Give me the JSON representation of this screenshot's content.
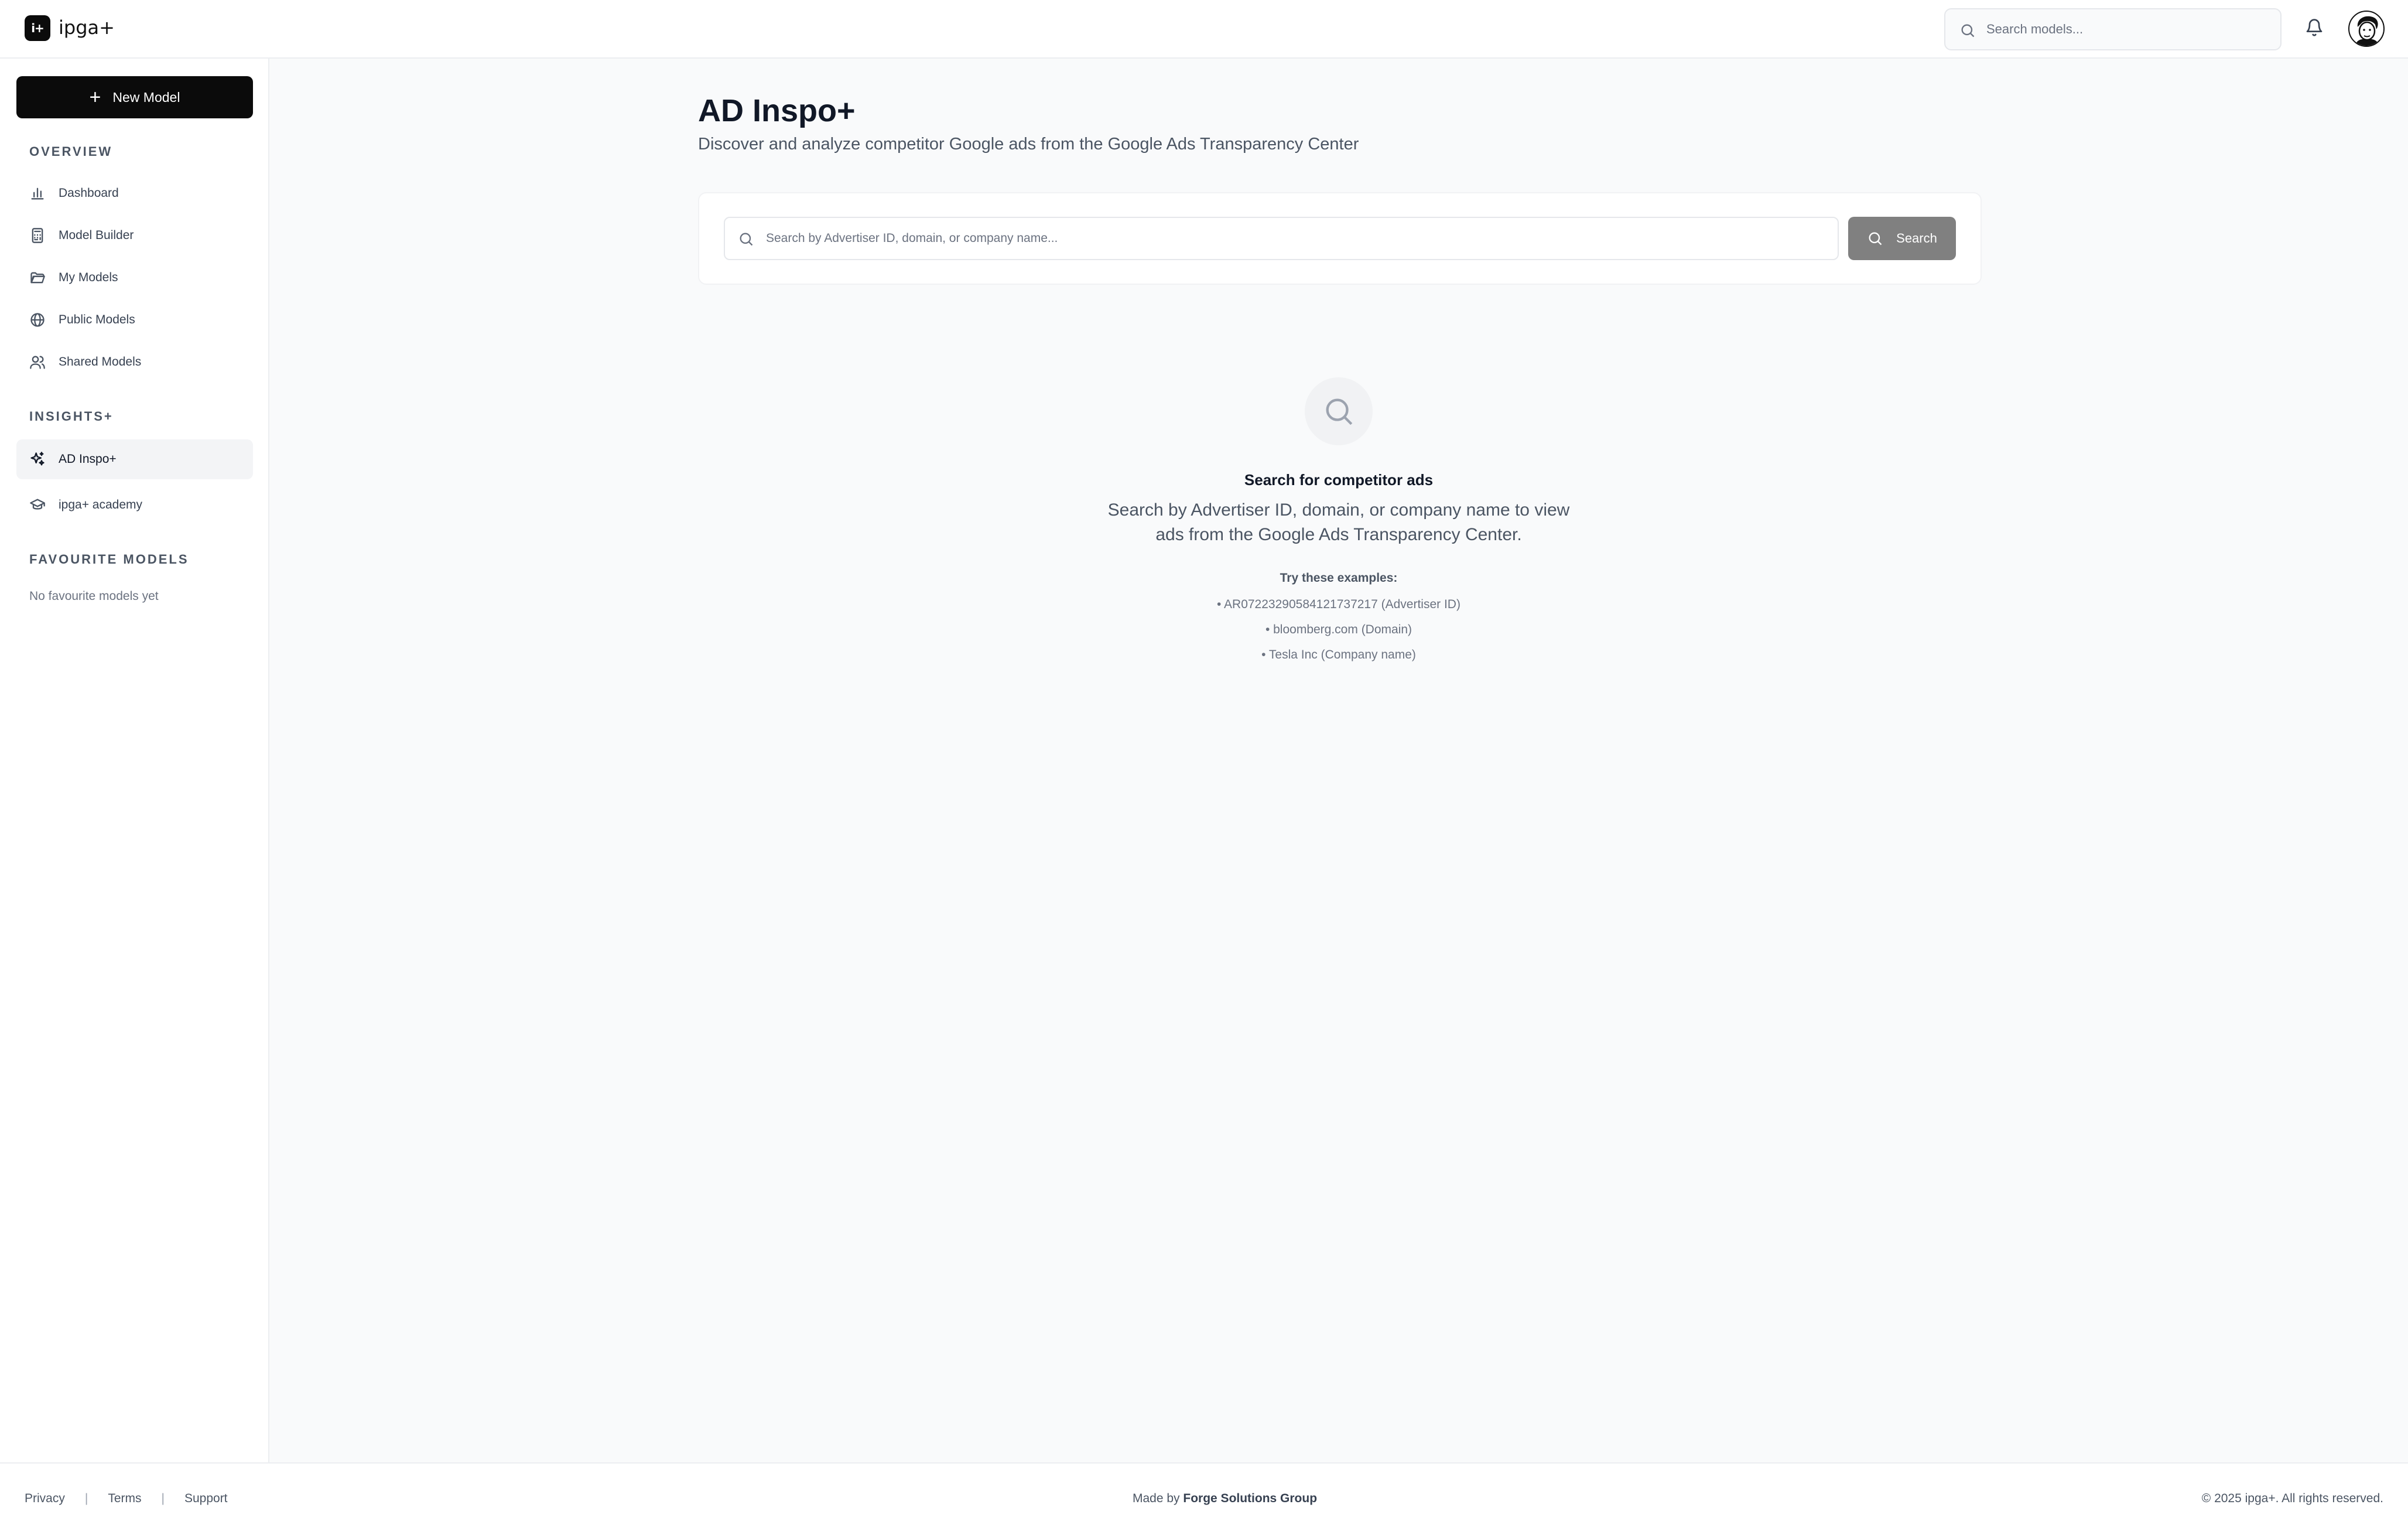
{
  "app": {
    "logo_mark": "i+",
    "name": "ipga+"
  },
  "header": {
    "search_placeholder": "Search models...",
    "icons": [
      "search-icon",
      "bell-icon",
      "avatar"
    ]
  },
  "sidebar": {
    "new_model_label": "New Model",
    "overview_label": "OVERVIEW",
    "overview_items": [
      {
        "label": "Dashboard",
        "icon": "bar-chart-icon"
      },
      {
        "label": "Model Builder",
        "icon": "calculator-icon"
      },
      {
        "label": "My Models",
        "icon": "folder-icon"
      },
      {
        "label": "Public Models",
        "icon": "globe-icon"
      },
      {
        "label": "Shared Models",
        "icon": "users-icon"
      }
    ],
    "insights_label": "INSIGHTS+",
    "insights_items": [
      {
        "label": "AD Inspo+",
        "icon": "sparkles-icon",
        "active": true
      },
      {
        "label": "ipga+ academy",
        "icon": "graduation-cap-icon",
        "active": false
      }
    ],
    "favourites_label": "FAVOURITE MODELS",
    "favourites_empty": "No favourite models yet"
  },
  "main": {
    "title": "AD Inspo+",
    "subtitle": "Discover and analyze competitor Google ads from the Google Ads Transparency Center",
    "search_placeholder": "Search by Advertiser ID, domain, or company name...",
    "search_button": "Search",
    "empty_state": {
      "title": "Search for competitor ads",
      "description": "Search by Advertiser ID, domain, or company name to view ads from the Google Ads Transparency Center.",
      "examples_title": "Try these examples:",
      "examples": [
        "• AR07223290584121737217 (Advertiser ID)",
        "• bloomberg.com (Domain)",
        "• Tesla Inc (Company name)"
      ]
    }
  },
  "footer": {
    "links": [
      "Privacy",
      "Terms",
      "Support"
    ],
    "separator": "|",
    "made_by_prefix": "Made by",
    "made_by_company": "Forge Solutions Group",
    "copyright": "© 2025 ipga+. All rights reserved."
  },
  "colors": {
    "primary": "#0b0b0b",
    "search_button": "#808080",
    "background": "#f9fafb",
    "active_nav": "#f3f4f6"
  }
}
